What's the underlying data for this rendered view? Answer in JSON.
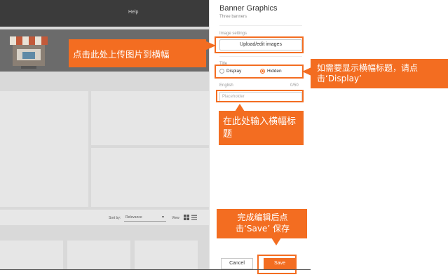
{
  "store_preview": {
    "help_label": "Help",
    "sort_label": "Sort by:",
    "sort_value": "Relevance",
    "view_label": "View"
  },
  "settings": {
    "title": "Banner Graphics",
    "subtitle": "Three banners",
    "image_settings_label": "Image settings",
    "upload_button": "Upload/edit images",
    "title_label": "Title",
    "option_display": "Display",
    "option_hidden": "Hidden",
    "selected_option": "Hidden",
    "language_label": "English",
    "char_counter": "0/50",
    "title_placeholder": "Placeholder",
    "cancel_button": "Cancel",
    "save_button": "Save"
  },
  "annotations": {
    "upload_tip": "点击此处上传图片到横幅",
    "display_tip": "如需要显示横幅标题，请点击‘Display’",
    "input_tip": "在此处输入横幅标题",
    "save_tip": "完成编辑后点击‘Save’ 保存"
  },
  "colors": {
    "accent": "#f36d21"
  }
}
